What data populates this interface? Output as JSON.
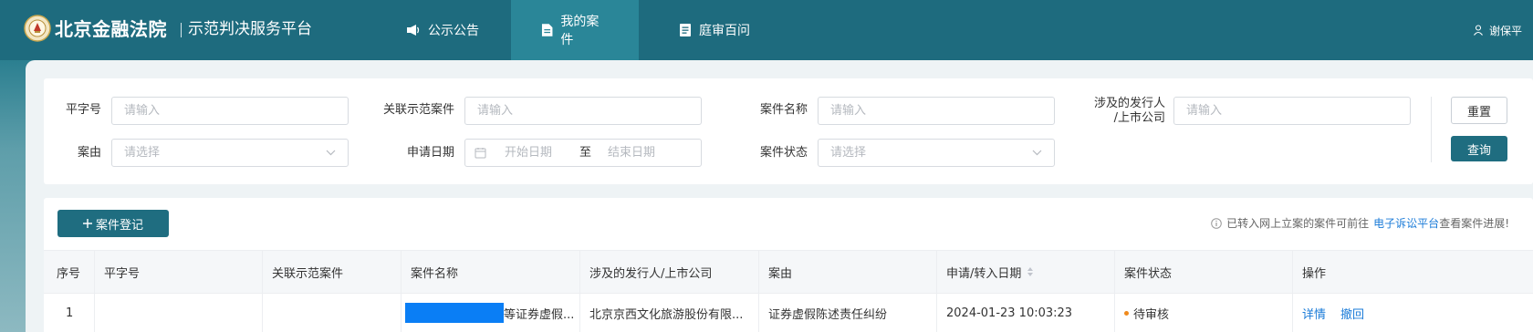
{
  "header": {
    "brand": "北京金融法院",
    "subtitle": "示范判决服务平台",
    "nav": [
      {
        "label": "公示公告",
        "icon": "megaphone-icon",
        "active": false
      },
      {
        "label": "我的案件",
        "icon": "document-icon",
        "active": true
      },
      {
        "label": "庭审百问",
        "icon": "list-document-icon",
        "active": false
      }
    ],
    "user": "谢保平"
  },
  "filters": {
    "ping_zi_hao": {
      "label": "平字号",
      "placeholder": "请输入"
    },
    "related_case": {
      "label": "关联示范案件",
      "placeholder": "请输入"
    },
    "case_name": {
      "label": "案件名称",
      "placeholder": "请输入"
    },
    "issuer": {
      "label_line1": "涉及的发行人",
      "label_line2": "/上市公司",
      "placeholder": "请输入"
    },
    "cause": {
      "label": "案由",
      "placeholder": "请选择"
    },
    "apply_date": {
      "label": "申请日期",
      "start": "开始日期",
      "sep": "至",
      "end": "结束日期"
    },
    "status": {
      "label": "案件状态",
      "placeholder": "请选择"
    }
  },
  "buttons": {
    "reset": "重置",
    "query": "查询",
    "register": "案件登记"
  },
  "notice": {
    "before": "已转入网上立案的案件可前往",
    "link": "电子诉讼平台",
    "after": "查看案件进展!"
  },
  "table": {
    "columns": [
      "序号",
      "平字号",
      "关联示范案件",
      "案件名称",
      "涉及的发行人/上市公司",
      "案由",
      "申请/转入日期",
      "案件状态",
      "操作"
    ],
    "rows": [
      {
        "index": "1",
        "ping_zi_hao": "",
        "related_case": "",
        "case_name": "等证券虚假...",
        "issuer": "北京京西文化旅游股份有限...",
        "cause": "证券虚假陈述责任纠纷",
        "date": "2024-01-23 10:03:23",
        "status": "待审核",
        "actions": [
          "详情",
          "撤回"
        ]
      }
    ]
  },
  "colors": {
    "primary": "#1f6d80",
    "nav_active": "#2a8698",
    "link": "#1a7bd8",
    "status_pending": "#f08a1c"
  }
}
